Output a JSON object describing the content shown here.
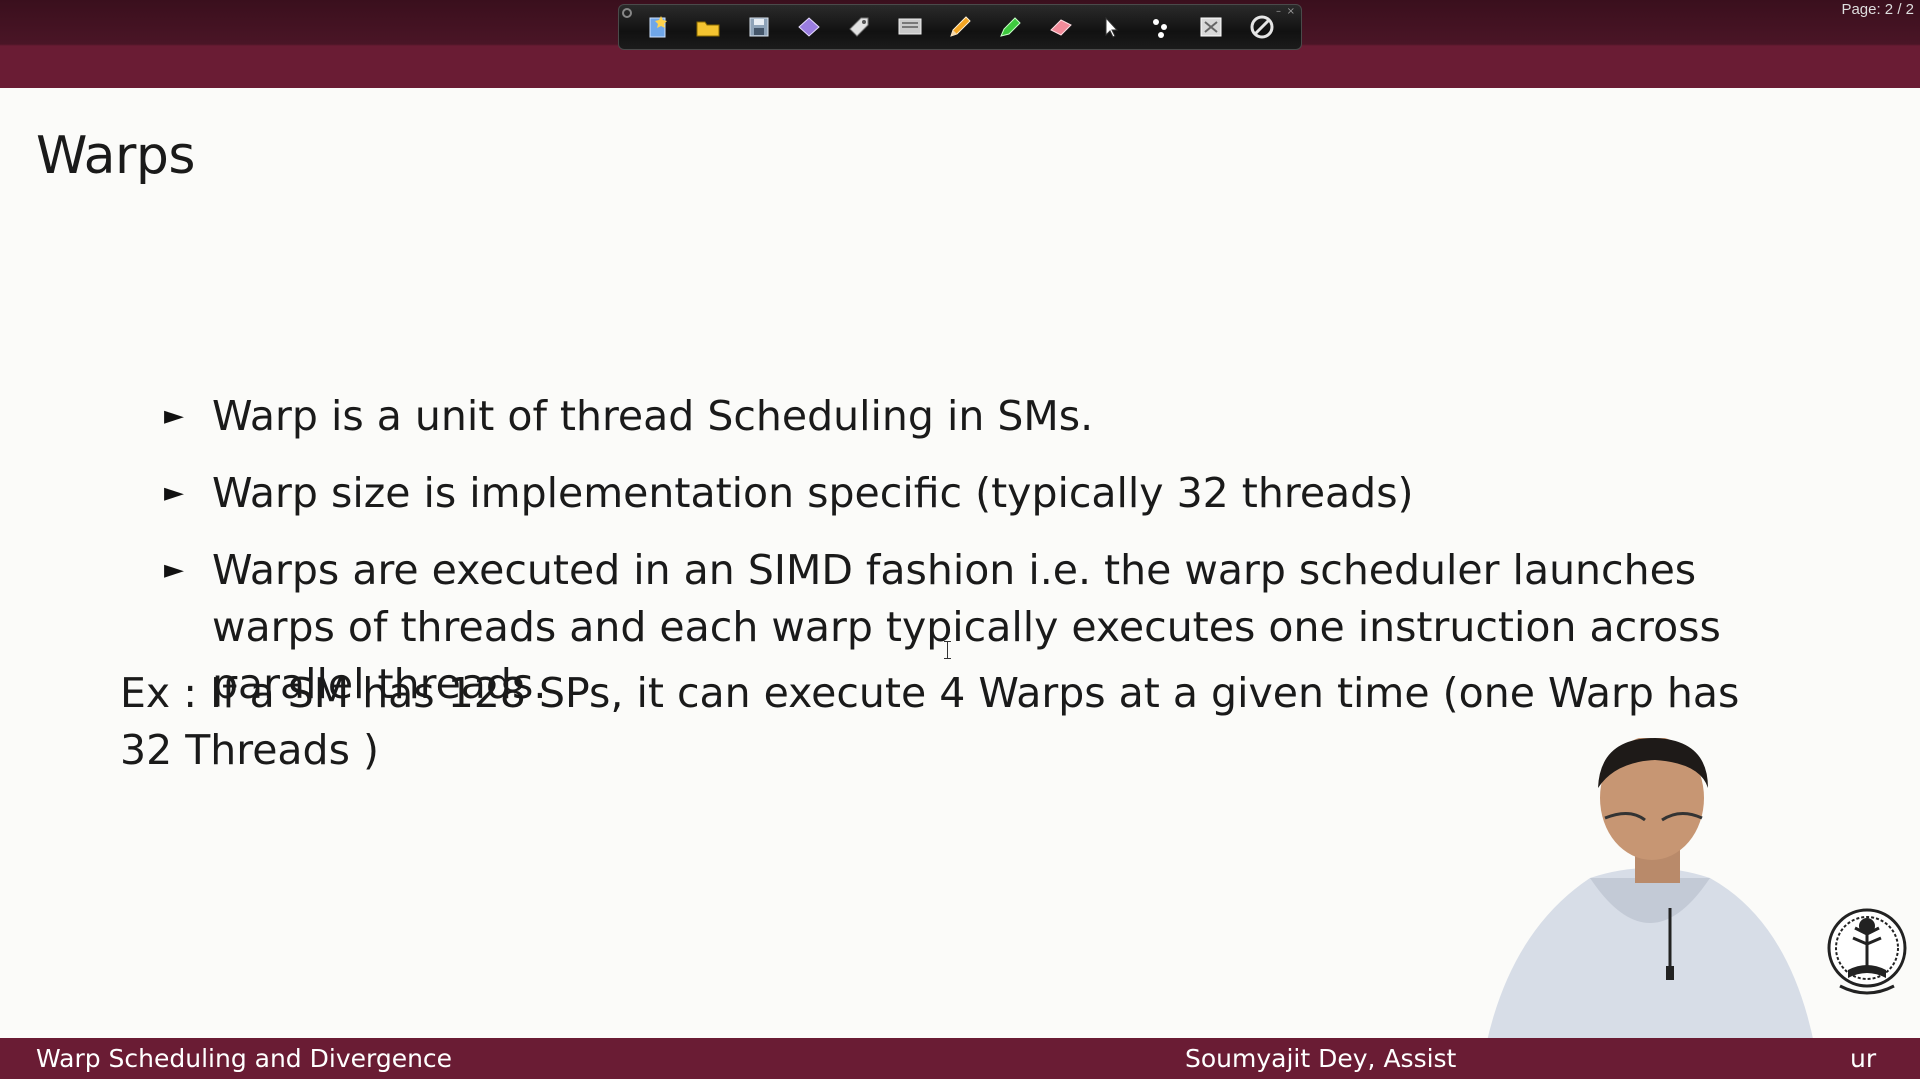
{
  "viewer": {
    "page_indicator": "Page: 2 / 2"
  },
  "toolbar": {
    "tools": [
      "new-page-icon",
      "open-folder-icon",
      "save-icon",
      "shape-icon",
      "tag-icon",
      "presentation-icon",
      "pencil-icon",
      "highlighter-icon",
      "eraser-icon",
      "pointer-icon",
      "laser-dots-icon",
      "screen-clear-icon",
      "disable-icon"
    ],
    "minimize_label": "–",
    "close_label": "×"
  },
  "slide": {
    "title": "Warps",
    "bullets": [
      "Warp is a unit of thread Scheduling in SMs.",
      "Warp size is implementation specific (typically 32 threads)",
      "Warps are executed in an SIMD fashion i.e. the warp scheduler launches warps of threads and each warp typically executes one instruction across parallel threads."
    ],
    "bullet_marker": "►",
    "example": "Ex : If a SM has 128 SPs, it can execute 4 Warps at a given time (one Warp has 32 Threads )"
  },
  "footer": {
    "left": "Warp Scheduling and Divergence",
    "right": "Soumyajit Dey, Assist",
    "right_tail": "ur"
  },
  "colors": {
    "maroon": "#6a1c34",
    "slide_background": "#fbfbf9",
    "text": "#1a1a1a"
  }
}
